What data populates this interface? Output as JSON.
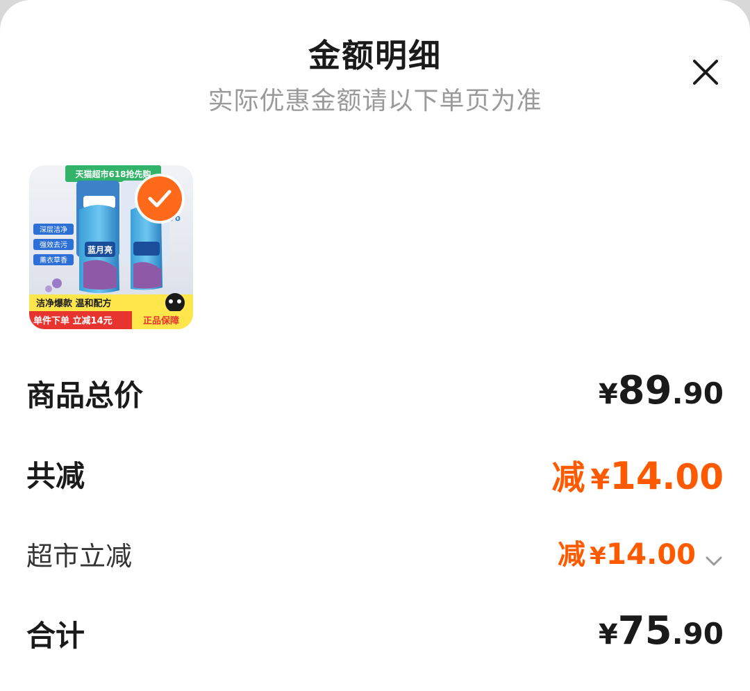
{
  "header": {
    "title": "金额明细",
    "subtitle": "实际优惠金额请以下单页为准"
  },
  "product": {
    "banner_text": "天猫超市618抢先购",
    "brand_text": "蓝月亮",
    "tags": [
      "深层洁净",
      "强效去污",
      "薰衣草香"
    ],
    "slogan": "洁净爆款 温和配方",
    "offer": "单件下单 立减14元",
    "guarantee": "正品保障",
    "selected": true
  },
  "rows": {
    "total_price": {
      "label": "商品总价",
      "currency": "¥",
      "integer": "89",
      "decimal": ".90"
    },
    "discount_total": {
      "label": "共减",
      "prefix": "减",
      "currency": "¥",
      "integer": "14",
      "decimal": ".00"
    },
    "supermarket_discount": {
      "label": "超市立减",
      "prefix": "减",
      "currency": "¥",
      "integer": "14",
      "decimal": ".00"
    },
    "sum": {
      "label": "合计",
      "currency": "¥",
      "integer": "75",
      "decimal": ".90"
    }
  },
  "colors": {
    "accent": "#ff5a00",
    "check_bg": "#ff6a1a",
    "text_primary": "#1a1a1a",
    "text_secondary": "#9a9a9a"
  },
  "icons": {
    "close": "close-icon",
    "check": "check-icon",
    "expand": "chevron-down-icon"
  }
}
